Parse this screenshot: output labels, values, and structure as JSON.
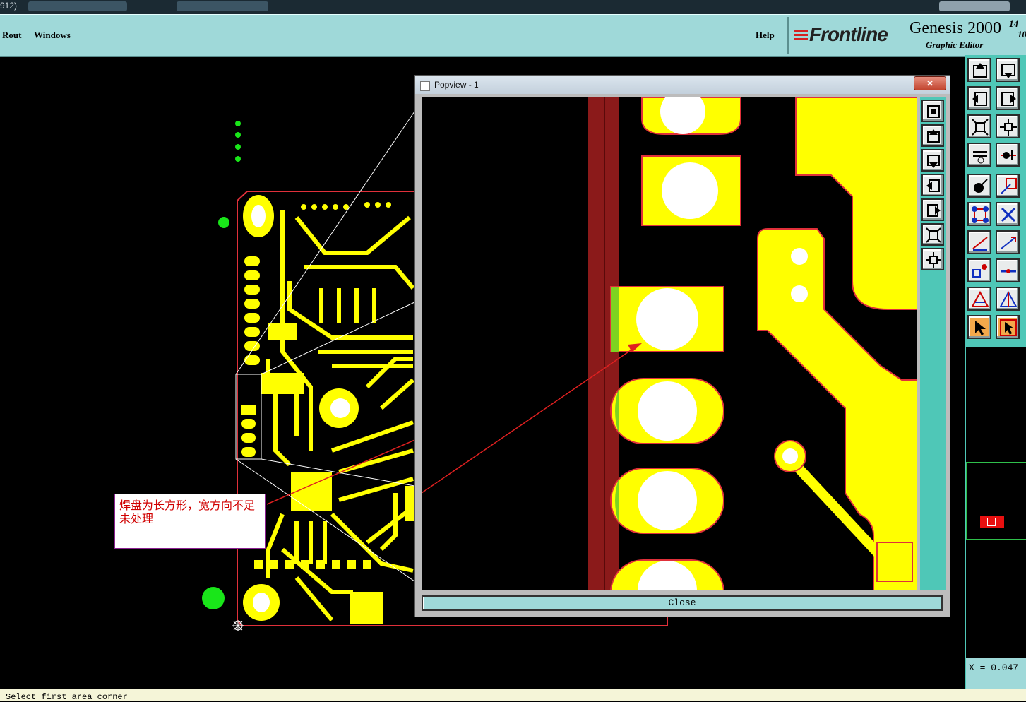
{
  "window": {
    "title_fragment": "912)"
  },
  "menu": {
    "items": [
      "Rout",
      "Windows"
    ],
    "help": "Help"
  },
  "brand": {
    "logo": "Frontline",
    "product": "Genesis 2000",
    "subtitle": "Graphic Editor",
    "version_top": "14",
    "version_bottom": "10"
  },
  "popview": {
    "title": "Popview - 1",
    "close_label": "Close",
    "close_x": "✕"
  },
  "annotation": {
    "text": "焊盘为长方形，宽方向不足未处理"
  },
  "coordinates": {
    "x_readout": "X = 0.047"
  },
  "status": {
    "prompt": "Select first area corner"
  },
  "colors": {
    "copper": "#ffff00",
    "board_outline": "#e0303a",
    "dielectric": "#8b1a1a",
    "menu_bg": "#9fd9d9",
    "toolbar_bg": "#4fc7b7",
    "annotation_text": "#d00000",
    "arrow": "#e02020"
  },
  "toolbar_icons": [
    "pan-up-icon",
    "pan-down-icon",
    "pan-left-icon",
    "pan-right-icon",
    "zoom-fit-icon",
    "zoom-center-icon",
    "measure-icon",
    "snap-icon",
    "select-feature-icon",
    "select-area-icon",
    "connect-icon",
    "cross-icon",
    "line-red-icon",
    "line-blue-icon",
    "point-icon",
    "h-line-icon",
    "triangle-red-icon",
    "triangle-blue-icon",
    "pointer-icon",
    "pointer-box-icon"
  ],
  "popview_tool_icons": [
    "pv-zoom-icon",
    "pv-up-icon",
    "pv-down-icon",
    "pv-left-icon",
    "pv-right-icon",
    "pv-fit-icon",
    "pv-center-icon"
  ]
}
